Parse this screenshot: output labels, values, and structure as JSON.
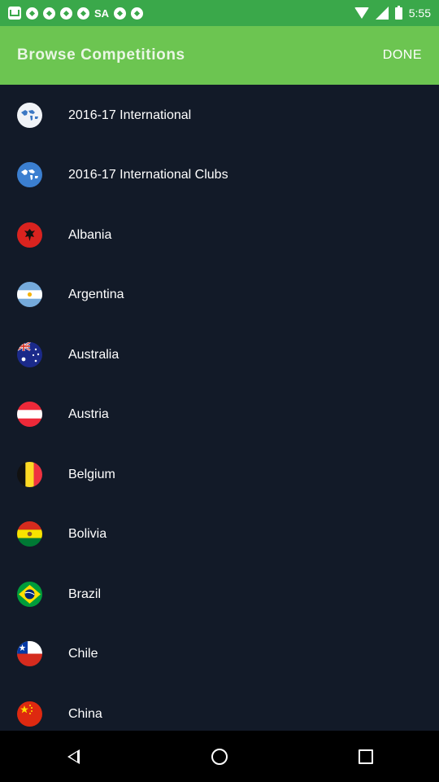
{
  "status_bar": {
    "carrier_tag": "SA",
    "time": "5:55"
  },
  "app_bar": {
    "title": "Browse Competitions",
    "done_label": "DONE"
  },
  "competitions": [
    {
      "label": "2016-17 International",
      "icon": "world-map-icon"
    },
    {
      "label": "2016-17 International Clubs",
      "icon": "world-map-icon"
    },
    {
      "label": "Albania",
      "icon": "albania-flag-icon"
    },
    {
      "label": "Argentina",
      "icon": "argentina-flag-icon"
    },
    {
      "label": "Australia",
      "icon": "australia-flag-icon"
    },
    {
      "label": "Austria",
      "icon": "austria-flag-icon"
    },
    {
      "label": "Belgium",
      "icon": "belgium-flag-icon"
    },
    {
      "label": "Bolivia",
      "icon": "bolivia-flag-icon"
    },
    {
      "label": "Brazil",
      "icon": "brazil-flag-icon"
    },
    {
      "label": "Chile",
      "icon": "chile-flag-icon"
    },
    {
      "label": "China",
      "icon": "china-flag-icon"
    }
  ],
  "colors": {
    "status_bar": "#3aa84a",
    "app_bar": "#6cc551",
    "background": "#121a28",
    "nav_bar": "#000000"
  }
}
